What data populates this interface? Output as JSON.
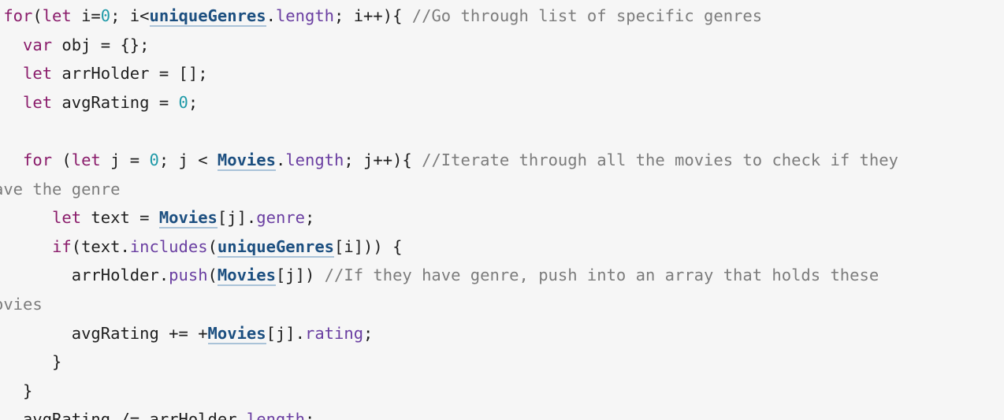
{
  "code": {
    "lines": [
      {
        "tokens": [
          {
            "t": " "
          },
          {
            "t": "for",
            "c": "kw"
          },
          {
            "t": "(",
            "c": "pl"
          },
          {
            "t": "let",
            "c": "kw"
          },
          {
            "t": " i=",
            "c": "pl"
          },
          {
            "t": "0",
            "c": "num"
          },
          {
            "t": "; i<",
            "c": "pl"
          },
          {
            "t": "uniqueGenres",
            "c": "link"
          },
          {
            "t": ".",
            "c": "pl"
          },
          {
            "t": "length",
            "c": "mem"
          },
          {
            "t": "; i++){ ",
            "c": "pl"
          },
          {
            "t": "//Go through list of specific genres",
            "c": "cm"
          }
        ]
      },
      {
        "tokens": [
          {
            "t": "   "
          },
          {
            "t": "var",
            "c": "kw"
          },
          {
            "t": " obj = {};",
            "c": "pl"
          }
        ]
      },
      {
        "tokens": [
          {
            "t": "   "
          },
          {
            "t": "let",
            "c": "kw"
          },
          {
            "t": " arrHolder = [];",
            "c": "pl"
          }
        ]
      },
      {
        "tokens": [
          {
            "t": "   "
          },
          {
            "t": "let",
            "c": "kw"
          },
          {
            "t": " avgRating = ",
            "c": "pl"
          },
          {
            "t": "0",
            "c": "num"
          },
          {
            "t": ";",
            "c": "pl"
          }
        ]
      },
      {
        "tokens": []
      },
      {
        "tokens": [
          {
            "t": "   "
          },
          {
            "t": "for",
            "c": "kw"
          },
          {
            "t": " (",
            "c": "pl"
          },
          {
            "t": "let",
            "c": "kw"
          },
          {
            "t": " j = ",
            "c": "pl"
          },
          {
            "t": "0",
            "c": "num"
          },
          {
            "t": "; j < ",
            "c": "pl"
          },
          {
            "t": "Movies",
            "c": "link"
          },
          {
            "t": ".",
            "c": "pl"
          },
          {
            "t": "length",
            "c": "mem"
          },
          {
            "t": "; j++){ ",
            "c": "pl"
          },
          {
            "t": "//Iterate through all the movies to check if they",
            "c": "cm"
          }
        ]
      },
      {
        "tokens": [
          {
            "t": "ave the genre",
            "c": "cm"
          }
        ]
      },
      {
        "tokens": [
          {
            "t": "      "
          },
          {
            "t": "let",
            "c": "kw"
          },
          {
            "t": " text = ",
            "c": "pl"
          },
          {
            "t": "Movies",
            "c": "link"
          },
          {
            "t": "[j].",
            "c": "pl"
          },
          {
            "t": "genre",
            "c": "mem"
          },
          {
            "t": ";",
            "c": "pl"
          }
        ]
      },
      {
        "tokens": [
          {
            "t": "      "
          },
          {
            "t": "if",
            "c": "kw"
          },
          {
            "t": "(text.",
            "c": "pl"
          },
          {
            "t": "includes",
            "c": "mem"
          },
          {
            "t": "(",
            "c": "pl"
          },
          {
            "t": "uniqueGenres",
            "c": "link"
          },
          {
            "t": "[i])) {",
            "c": "pl"
          }
        ]
      },
      {
        "tokens": [
          {
            "t": "        "
          },
          {
            "t": "arrHolder.",
            "c": "pl"
          },
          {
            "t": "push",
            "c": "mem"
          },
          {
            "t": "(",
            "c": "pl"
          },
          {
            "t": "Movies",
            "c": "link"
          },
          {
            "t": "[j]) ",
            "c": "pl"
          },
          {
            "t": "//If they have genre, push into an array that holds these",
            "c": "cm"
          }
        ]
      },
      {
        "tokens": [
          {
            "t": "ovies",
            "c": "cm"
          }
        ]
      },
      {
        "tokens": [
          {
            "t": "        "
          },
          {
            "t": "avgRating += +",
            "c": "pl"
          },
          {
            "t": "Movies",
            "c": "link"
          },
          {
            "t": "[j].",
            "c": "pl"
          },
          {
            "t": "rating",
            "c": "mem"
          },
          {
            "t": ";",
            "c": "pl"
          }
        ]
      },
      {
        "tokens": [
          {
            "t": "      }",
            "c": "pl"
          }
        ]
      },
      {
        "tokens": [
          {
            "t": "   }",
            "c": "pl"
          }
        ]
      },
      {
        "tokens": [
          {
            "t": "   avgRating /= arrHolder.",
            "c": "pl"
          },
          {
            "t": "length",
            "c": "mem"
          },
          {
            "t": ";",
            "c": "pl"
          }
        ]
      }
    ]
  }
}
